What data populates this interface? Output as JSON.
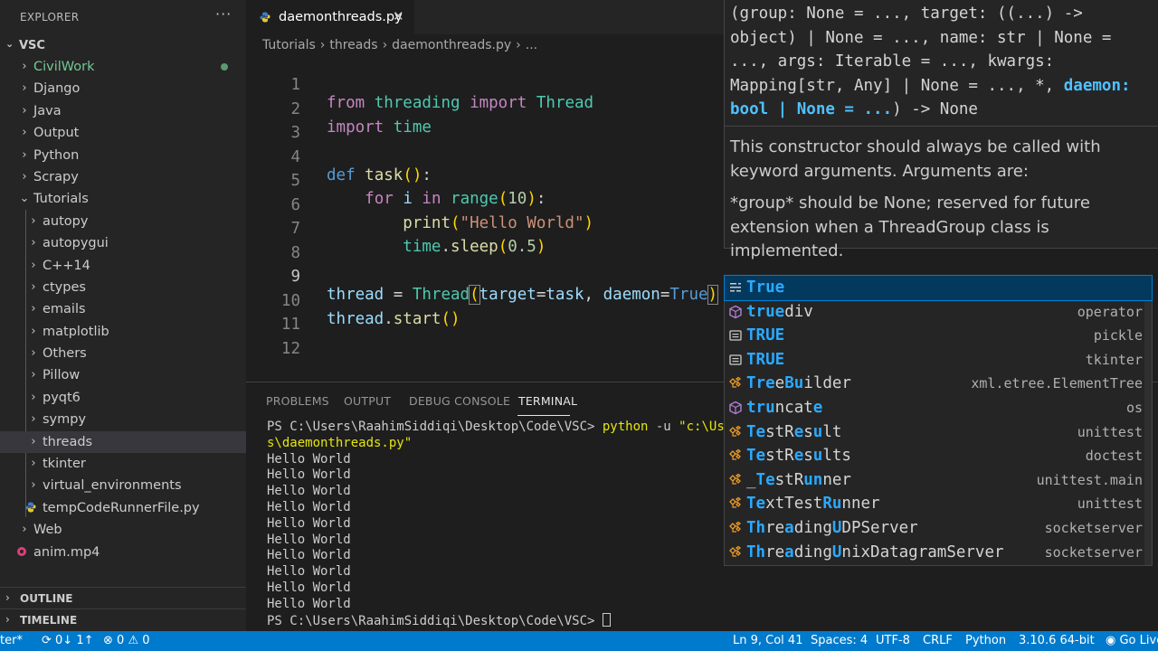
{
  "sidebar": {
    "title": "EXPLORER",
    "more": "···",
    "root": "VSC",
    "items": [
      {
        "label": "CivilWork",
        "depth": 1,
        "kind": "folder",
        "modified": true
      },
      {
        "label": "Django",
        "depth": 1,
        "kind": "folder"
      },
      {
        "label": "Java",
        "depth": 1,
        "kind": "folder"
      },
      {
        "label": "Output",
        "depth": 1,
        "kind": "folder"
      },
      {
        "label": "Python",
        "depth": 1,
        "kind": "folder"
      },
      {
        "label": "Scrapy",
        "depth": 1,
        "kind": "folder"
      },
      {
        "label": "Tutorials",
        "depth": 1,
        "kind": "folder-open"
      },
      {
        "label": "autopy",
        "depth": 2,
        "kind": "folder"
      },
      {
        "label": "autopygui",
        "depth": 2,
        "kind": "folder"
      },
      {
        "label": "C++14",
        "depth": 2,
        "kind": "folder"
      },
      {
        "label": "ctypes",
        "depth": 2,
        "kind": "folder"
      },
      {
        "label": "emails",
        "depth": 2,
        "kind": "folder"
      },
      {
        "label": "matplotlib",
        "depth": 2,
        "kind": "folder"
      },
      {
        "label": "Others",
        "depth": 2,
        "kind": "folder"
      },
      {
        "label": "Pillow",
        "depth": 2,
        "kind": "folder"
      },
      {
        "label": "pyqt6",
        "depth": 2,
        "kind": "folder"
      },
      {
        "label": "sympy",
        "depth": 2,
        "kind": "folder"
      },
      {
        "label": "threads",
        "depth": 2,
        "kind": "folder",
        "selected": true
      },
      {
        "label": "tkinter",
        "depth": 2,
        "kind": "folder"
      },
      {
        "label": "virtual_environments",
        "depth": 2,
        "kind": "folder"
      },
      {
        "label": "tempCodeRunnerFile.py",
        "depth": 2,
        "kind": "file-py"
      },
      {
        "label": "Web",
        "depth": 1,
        "kind": "folder"
      },
      {
        "label": "anim.mp4",
        "depth": 1,
        "kind": "file-mp4"
      }
    ],
    "outline": "OUTLINE",
    "timeline": "TIMELINE"
  },
  "editor": {
    "tab_label": "daemonthreads.py",
    "tab_close": "✕",
    "breadcrumb": [
      "Tutorials",
      "›",
      "threads",
      "›",
      "daemonthreads.py",
      "›",
      "..."
    ],
    "active_line": 9
  },
  "panel": {
    "tabs": [
      "PROBLEMS",
      "OUTPUT",
      "DEBUG CONSOLE",
      "TERMINAL"
    ],
    "active_tab": "TERMINAL",
    "terminal": {
      "prompt": "PS C:\\Users\\RaahimSiddiqi\\Desktop\\Code\\VSC> ",
      "cmd": "python",
      "flag": " -u ",
      "arg_start": "\"c:\\User",
      "arg_cont": "s\\daemonthreads.py\"",
      "output_lines": [
        "Hello World",
        "Hello World",
        "Hello World",
        "Hello World",
        "Hello World",
        "Hello World",
        "Hello World",
        "Hello World",
        "Hello World",
        "Hello World"
      ],
      "final_prompt": "PS C:\\Users\\RaahimSiddiqi\\Desktop\\Code\\VSC> "
    }
  },
  "hover": {
    "doc1_l1": "This constructor should always be called with",
    "doc1_l2": "keyword arguments. Arguments are:",
    "doc2_l1": "*group* should be None; reserved for future",
    "doc2_l2": "extension when a ThreadGroup class is implemented."
  },
  "suggest": {
    "items": [
      {
        "label": "True",
        "match": 4,
        "detail": "",
        "icon": "keyword-icon",
        "selected": true
      },
      {
        "label": "truediv",
        "match": 4,
        "detail": "operator",
        "icon": "module-icon"
      },
      {
        "label": "TRUE",
        "match": 4,
        "detail": "pickle",
        "icon": "variable-icon"
      },
      {
        "label": "TRUE",
        "match": 4,
        "detail": "tkinter",
        "icon": "variable-icon"
      },
      {
        "label": "TreeBuilder",
        "match": "TreeBu",
        "detail": "xml.etree.ElementTree",
        "icon": "class-icon"
      },
      {
        "label": "truncate",
        "match": "truncate",
        "detail": "os",
        "icon": "module-icon"
      },
      {
        "label": "TestResult",
        "match": "T-e-Re-u",
        "detail": "unittest",
        "icon": "class-icon"
      },
      {
        "label": "TestResults",
        "match": "T-e-Re-u",
        "detail": "doctest",
        "icon": "class-icon"
      },
      {
        "label": "_TestRunner",
        "match": "T-e-Ru",
        "detail": "unittest.main",
        "icon": "class-icon"
      },
      {
        "label": "TextTestRunner",
        "match": "T-e-Ru",
        "detail": "unittest",
        "icon": "class-icon"
      },
      {
        "label": "ThreadingUDPServer",
        "match": "T-r-e-U",
        "detail": "socketserver",
        "icon": "class-icon"
      },
      {
        "label": "ThreadingUnixDatagramServer",
        "match": "T-r-e-U",
        "detail": "socketserver",
        "icon": "class-icon"
      }
    ]
  },
  "statusbar": {
    "branch": "ter*",
    "sync": "⟳ 0↓ 1↑",
    "errors": "0",
    "warnings": "0",
    "position": "Ln 9, Col 41",
    "spaces": "Spaces: 4",
    "encoding": "UTF-8",
    "eol": "CRLF",
    "language": "Python",
    "interpreter": "3.10.6 64-bit",
    "golive": "Go Live"
  },
  "colors": {
    "accent": "#007acc",
    "keyword": "#c586c0",
    "type": "#4ec9b0",
    "function": "#dcdcaa",
    "string": "#ce9178",
    "number": "#b5cea8",
    "variable": "#9cdcfe",
    "match": "#2aaaff"
  }
}
